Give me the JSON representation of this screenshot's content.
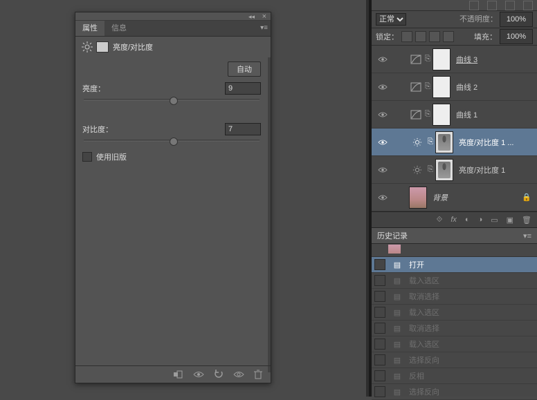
{
  "props": {
    "tabs": [
      "属性",
      "信息"
    ],
    "title": "亮度/对比度",
    "auto": "自动",
    "brightness_label": "亮度：",
    "brightness_value": "9",
    "contrast_label": "对比度：",
    "contrast_value": "7",
    "legacy_label": "使用旧版"
  },
  "layers_panel": {
    "blend_mode": "正常",
    "opacity_label": "不透明度：",
    "opacity_value": "100%",
    "lock_label": "锁定：",
    "fill_label": "填充：",
    "fill_value": "100%",
    "layers": [
      {
        "name": "曲线 3",
        "type": "curves",
        "underline": true
      },
      {
        "name": "曲线 2",
        "type": "curves"
      },
      {
        "name": "曲线 1",
        "type": "curves"
      },
      {
        "name": "亮度/对比度 1 ...",
        "type": "brightness",
        "selected": true
      },
      {
        "name": "亮度/对比度 1",
        "type": "brightness"
      },
      {
        "name": "背景",
        "type": "bg",
        "locked": true
      }
    ]
  },
  "history": {
    "title": "历史记录",
    "items": [
      {
        "label": "打开",
        "active": true,
        "selected": true
      },
      {
        "label": "载入选区"
      },
      {
        "label": "取消选择"
      },
      {
        "label": "载入选区"
      },
      {
        "label": "取消选择"
      },
      {
        "label": "载入选区"
      },
      {
        "label": "选择反向"
      },
      {
        "label": "反相"
      },
      {
        "label": "选择反向"
      }
    ]
  }
}
